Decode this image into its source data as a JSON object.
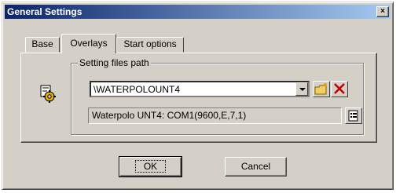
{
  "window": {
    "title": "General Settings",
    "close_glyph": "×"
  },
  "tabs": [
    {
      "label": "Base"
    },
    {
      "label": "Overlays"
    },
    {
      "label": "Start options"
    }
  ],
  "group": {
    "legend": "Setting files path"
  },
  "path_combo": {
    "value": "\\WATERPOLOUNT4"
  },
  "info_line": {
    "text": "Waterpolo UNT4: COM1(9600,E,7,1)"
  },
  "icons": {
    "settings": "gear-settings-icon",
    "new_folder": "new-folder-icon",
    "delete": "delete-x-icon",
    "properties": "properties-icon"
  },
  "buttons": {
    "ok": "OK",
    "cancel": "Cancel"
  },
  "colors": {
    "titlebar_start": "#0a246a",
    "titlebar_end": "#a6caf0",
    "delete_red": "#c00000"
  }
}
